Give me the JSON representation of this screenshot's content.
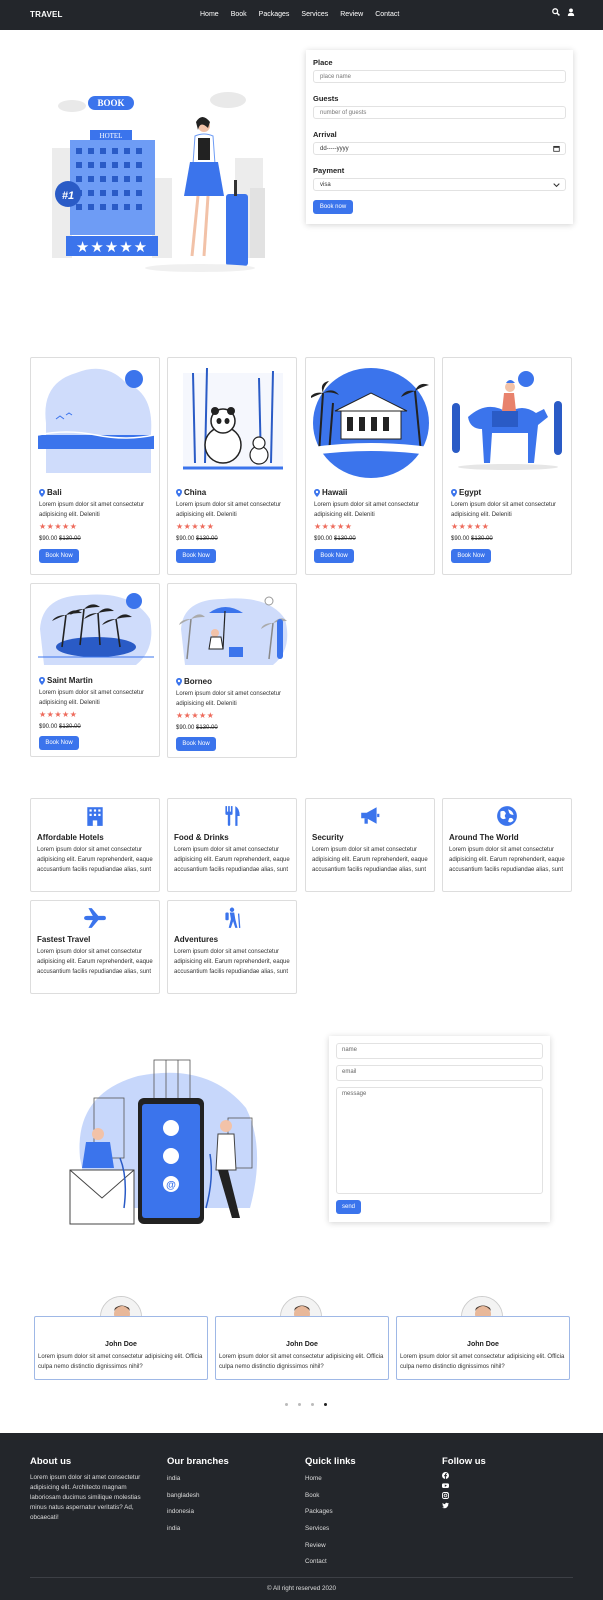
{
  "nav": {
    "brand": "TRAVEL",
    "links": [
      "Home",
      "Book",
      "Packages",
      "Services",
      "Review",
      "Contact"
    ],
    "icons": [
      "search-icon",
      "user-icon"
    ]
  },
  "hero": {
    "illustration_text": {
      "book": "BOOK",
      "hotel": "HOTEL",
      "rank": "#1"
    },
    "form": {
      "place_label": "Place",
      "place_placeholder": "place name",
      "guests_label": "Guests",
      "guests_placeholder": "number of guests",
      "arrival_label": "Arrival",
      "arrival_value": "dd-----yyyy",
      "payment_label": "Payment",
      "payment_value": "visa",
      "submit": "Book now"
    }
  },
  "packages": [
    {
      "name": "Bali",
      "desc": "Lorem ipsum dolor sit amet consectetur adipisicing elit. Deleniti",
      "stars": "★★★★★",
      "price": "$90.00",
      "old_price": "$130.00",
      "button": "Book Now"
    },
    {
      "name": "China",
      "desc": "Lorem ipsum dolor sit amet consectetur adipisicing elit. Deleniti",
      "stars": "★★★★★",
      "price": "$90.00",
      "old_price": "$130.00",
      "button": "Book Now"
    },
    {
      "name": "Hawaii",
      "desc": "Lorem ipsum dolor sit amet consectetur adipisicing elit. Deleniti",
      "stars": "★★★★★",
      "price": "$90.00",
      "old_price": "$130.00",
      "button": "Book Now"
    },
    {
      "name": "Egypt",
      "desc": "Lorem ipsum dolor sit amet consectetur adipisicing elit. Deleniti",
      "stars": "★★★★★",
      "price": "$90.00",
      "old_price": "$130.00",
      "button": "Book Now"
    },
    {
      "name": "Saint Martin",
      "desc": "Lorem ipsum dolor sit amet consectetur adipisicing elit. Deleniti",
      "stars": "★★★★★",
      "price": "$90.00",
      "old_price": "$130.00",
      "button": "Book Now"
    },
    {
      "name": "Borneo",
      "desc": "Lorem ipsum dolor sit amet consectetur adipisicing elit. Deleniti",
      "stars": "★★★★★",
      "price": "$90.00",
      "old_price": "$130.00",
      "button": "Book Now"
    }
  ],
  "services": [
    {
      "title": "Affordable Hotels",
      "icon": "hotel-icon",
      "desc": "Lorem ipsum dolor sit amet consectetur adipisicing elit. Earum reprehenderit, eaque accusantium facilis repudiandae alias, sunt"
    },
    {
      "title": "Food & Drinks",
      "icon": "utensils-icon",
      "desc": "Lorem ipsum dolor sit amet consectetur adipisicing elit. Earum reprehenderit, eaque accusantium facilis repudiandae alias, sunt"
    },
    {
      "title": "Security",
      "icon": "megaphone-icon",
      "desc": "Lorem ipsum dolor sit amet consectetur adipisicing elit. Earum reprehenderit, eaque accusantium facilis repudiandae alias, sunt"
    },
    {
      "title": "Around The World",
      "icon": "globe-icon",
      "desc": "Lorem ipsum dolor sit amet consectetur adipisicing elit. Earum reprehenderit, eaque accusantium facilis repudiandae alias, sunt"
    },
    {
      "title": "Fastest Travel",
      "icon": "plane-icon",
      "desc": "Lorem ipsum dolor sit amet consectetur adipisicing elit. Earum reprehenderit, eaque accusantium facilis repudiandae alias, sunt"
    },
    {
      "title": "Adventures",
      "icon": "hiker-icon",
      "desc": "Lorem ipsum dolor sit amet consectetur adipisicing elit. Earum reprehenderit, eaque accusantium facilis repudiandae alias, sunt"
    }
  ],
  "contact": {
    "name_placeholder": "name",
    "email_placeholder": "email",
    "message_placeholder": "message",
    "send": "send"
  },
  "reviews": [
    {
      "name": "John Doe",
      "text": "Lorem ipsum dolor sit amet consectetur adipisicing elit. Officia culpa nemo distinctio dignissimos nihil?"
    },
    {
      "name": "John Doe",
      "text": "Lorem ipsum dolor sit amet consectetur adipisicing elit. Officia culpa nemo distinctio dignissimos nihil?"
    },
    {
      "name": "John Doe",
      "text": "Lorem ipsum dolor sit amet consectetur adipisicing elit. Officia culpa nemo distinctio dignissimos nihil?"
    }
  ],
  "carousel": {
    "slide_count": 4,
    "active_index": 3
  },
  "footer": {
    "about_title": "About us",
    "about_text": "Lorem ipsum dolor sit amet consectetur adipisicing elit. Architecto magnam laboriosam ducimus similique molestias minus natus aspernatur veritatis? Ad, obcaecati!",
    "branches_title": "Our branches",
    "branches": [
      "india",
      "bangladesh",
      "indonesia",
      "india"
    ],
    "links_title": "Quick links",
    "links": [
      "Home",
      "Book",
      "Packages",
      "Services",
      "Review",
      "Contact"
    ],
    "follow_title": "Follow us",
    "social_icons": [
      "facebook-icon",
      "youtube-icon",
      "instagram-icon",
      "twitter-icon"
    ],
    "copyright": "© All right reserved 2020"
  },
  "colors": {
    "accent": "#3b74ec",
    "dark": "#23262b",
    "star": "#ee6b5c"
  }
}
